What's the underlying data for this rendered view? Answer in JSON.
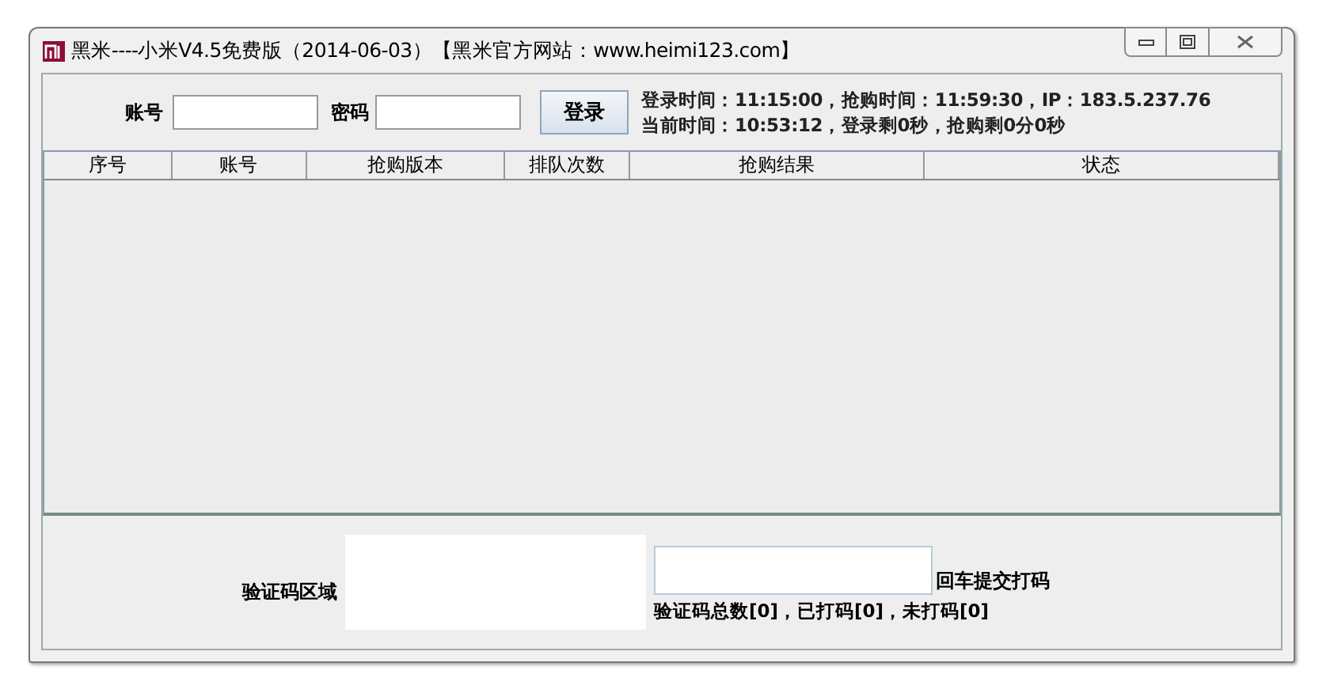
{
  "window": {
    "title": "黑米----小米V4.5免费版（2014-06-03）【黑米官方网站：www.heimi123.com】"
  },
  "login": {
    "account_label": "账号",
    "password_label": "密码",
    "login_button": "登录",
    "info_lines": [
      "登录时间：11:15:00，抢购时间：11:59:30，IP：183.5.237.76",
      "当前时间：10:53:12，登录剩0秒，抢购剩0分0秒"
    ]
  },
  "table": {
    "columns": [
      "序号",
      "账号",
      "抢购版本",
      "排队次数",
      "抢购结果",
      "状态"
    ]
  },
  "captcha": {
    "area_label": "验证码区域",
    "submit_hint": "回车提交打码",
    "stats": "验证码总数[0]，已打码[0]，未打码[0]"
  }
}
